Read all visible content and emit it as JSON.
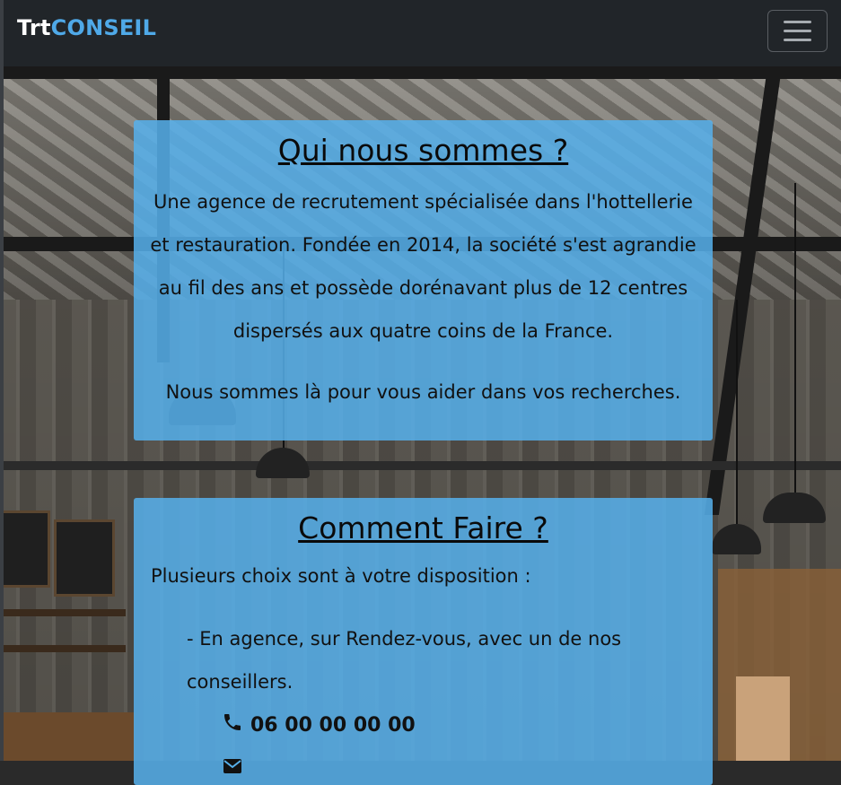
{
  "navbar": {
    "brand_part1": "Trt",
    "brand_part2": "CONSEIL",
    "toggle_label": "Toggle navigation"
  },
  "about": {
    "title": "Qui nous sommes ?",
    "line1": "Une agence de recrutement spécialisée dans l'hottellerie",
    "line2": "et restauration. Fondée en 2014, la société s'est agrandie",
    "line3": "au fil des ans et possède dorénavant plus de 12 centres",
    "line4": "dispersés aux quatre coins de la France.",
    "line5": "Nous sommes là pour vous aider dans vos recherches."
  },
  "how": {
    "title": "Comment Faire ?",
    "lead": "Plusieurs choix sont à votre disposition :",
    "option1_line1": "- En agence, sur Rendez-vous, avec un de nos",
    "option1_line2": "conseillers.",
    "phone": "06 00 00 00 00",
    "phone_icon": "phone-icon",
    "email_icon": "envelope-icon"
  },
  "colors": {
    "navbar_bg": "#212529",
    "brand_accent": "#4fa9e8",
    "card_bg": "#56b0eb"
  }
}
